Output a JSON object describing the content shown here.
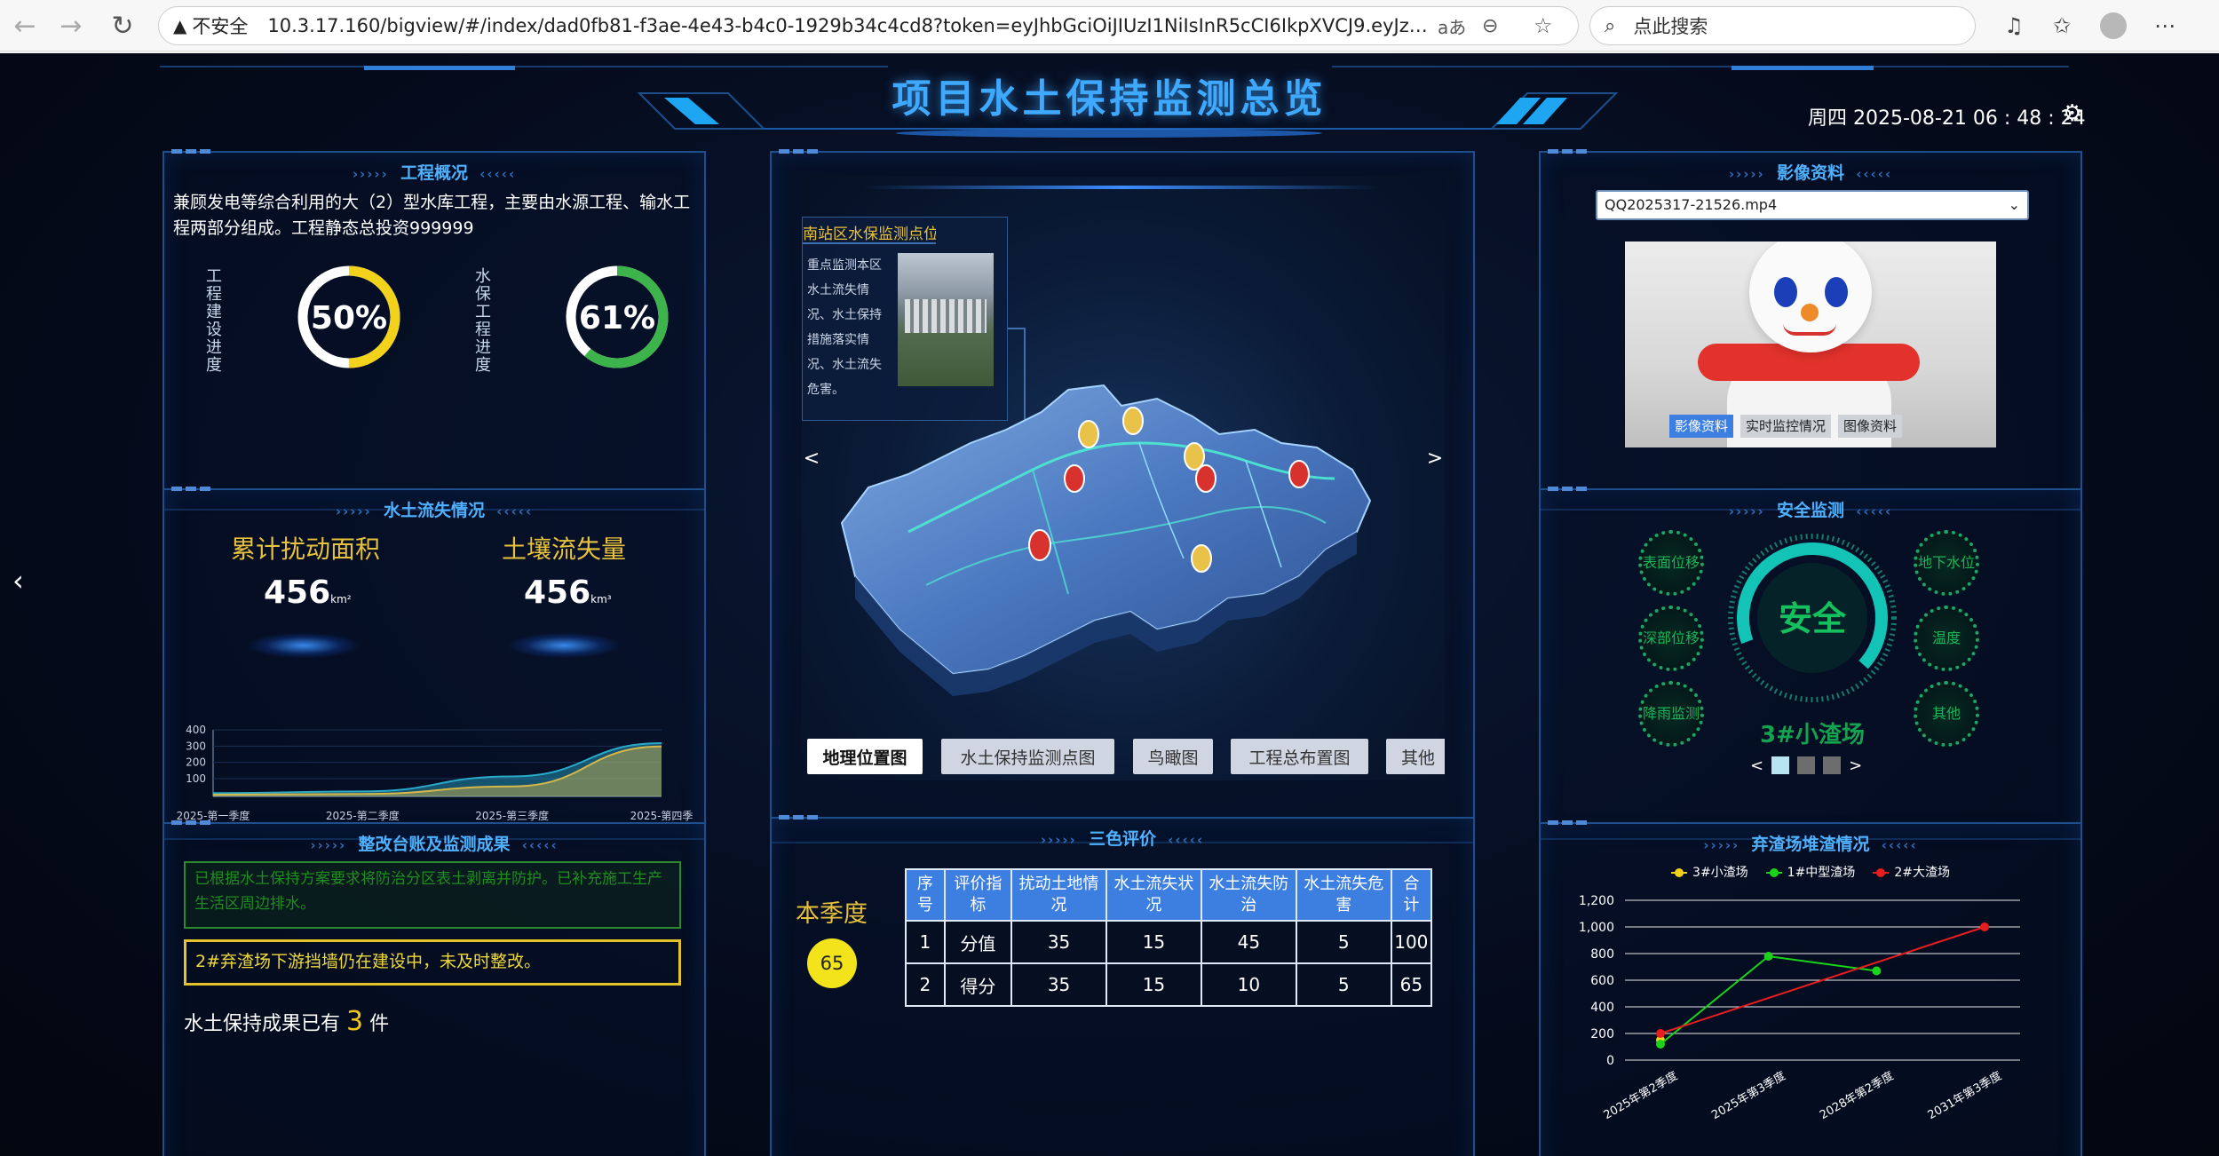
{
  "browser": {
    "back_icon": "arrow-left-icon",
    "forward_icon": "arrow-right-icon",
    "refresh_icon": "refresh-icon",
    "security_label": "不安全",
    "url": "10.3.17.160/bigview/#/index/dad0fb81-f3ae-4e43-b4c0-1929b34c4cd8?token=eyJhbGciOiJIUzI1NiIsInR5cCI6IkpXVCJ9.eyJzdWIiOiJy...",
    "read_aloud_label": "aあ",
    "search_placeholder": "点此搜索"
  },
  "header": {
    "title": "项目水土保持监测总览",
    "datetime": "周四 2025-08-21 06 : 48 : 24"
  },
  "overview": {
    "title": "工程概况",
    "description": "兼顾发电等综合利用的大（2）型水库工程，主要由水源工程、输水工程两部分组成。工程静态总投资999999",
    "gauges": [
      {
        "label": "工程建设进度",
        "percent": 50,
        "text": "50%",
        "color": "#f2d21b"
      },
      {
        "label": "水保工程进度",
        "percent": 61,
        "text": "61%",
        "color": "#3cb44b"
      }
    ]
  },
  "soil_loss": {
    "title": "水土流失情况",
    "stats": [
      {
        "label": "累计扰动面积",
        "value": "456",
        "unit": "km²"
      },
      {
        "label": "土壤流失量",
        "value": "456",
        "unit": "km³"
      }
    ]
  },
  "chart_soil": {
    "type": "area",
    "categories": [
      "2025-第一季度",
      "2025-第二季度",
      "2025-第三季度",
      "2025-第四季"
    ],
    "yticks": [
      "400",
      "300",
      "200",
      "100"
    ],
    "ylim": [
      0,
      400
    ],
    "series": [
      {
        "values": [
          20,
          30,
          120,
          320
        ],
        "color": "#2aa9c9"
      },
      {
        "values": [
          10,
          15,
          60,
          300
        ],
        "color": "#d6b84a"
      }
    ]
  },
  "rectify": {
    "title": "整改台账及监测成果",
    "notice_green": "已根据水土保持方案要求将防治分区表土剥离并防护。已补充施工生产生活区周边排水。",
    "notice_yellow": "2#弃渣场下游挡墙仍在建设中，未及时整改。",
    "result_prefix": "水土保持成果已有",
    "result_count": "3",
    "result_suffix": "件"
  },
  "map": {
    "prev_label": "<",
    "next_label": ">",
    "info_title": "南站区水保监测点位",
    "info_text": "重点监测本区水土流失情况、水土保持措施落实情况、水土流失危害。",
    "tabs": [
      "地理位置图",
      "水土保持监测点图",
      "鸟瞰图",
      "工程总布置图",
      "其他"
    ],
    "active_tab": 0
  },
  "tri_eval": {
    "title": "三色评价",
    "season_label": "本季度",
    "season_score": "65",
    "headers": [
      "序号",
      "评价指标",
      "扰动土地情况",
      "水土流失状况",
      "水土流失防治",
      "水土流失危害",
      "合计"
    ],
    "rows": [
      [
        "1",
        "分值",
        "35",
        "15",
        "45",
        "5",
        "100"
      ],
      [
        "2",
        "得分",
        "35",
        "15",
        "10",
        "5",
        "65"
      ]
    ]
  },
  "media": {
    "title": "影像资料",
    "selected_file": "QQ2025317-21526.mp4",
    "tabs": [
      "影像资料",
      "实时监控情况",
      "图像资料"
    ],
    "active_tab": 0
  },
  "safety": {
    "title": "安全监测",
    "status": "安全",
    "site": "3#小渣场",
    "left_items": [
      "表面位移",
      "深部位移",
      "降雨监测"
    ],
    "right_items": [
      "地下水位",
      "温度",
      "其他"
    ],
    "pager_prev": "<",
    "pager_next": ">"
  },
  "spoil_chart": {
    "title": "弃渣场堆渣情况",
    "chart_data": {
      "type": "line",
      "categories": [
        "2025年第2季度",
        "2025年第3季度",
        "2028年第2季度",
        "2031年第3季度"
      ],
      "yticks": [
        "1,200",
        "1,000",
        "800",
        "600",
        "400",
        "200",
        "0"
      ],
      "ylim": [
        0,
        1200
      ],
      "series": [
        {
          "name": "3#小渣场",
          "color": "#f2d21b",
          "values": [
            150,
            null,
            null,
            null
          ]
        },
        {
          "name": "1#中型渣场",
          "color": "#19d419",
          "values": [
            120,
            780,
            670,
            null
          ]
        },
        {
          "name": "2#大渣场",
          "color": "#e81d1d",
          "values": [
            200,
            null,
            null,
            1000
          ]
        }
      ]
    }
  }
}
